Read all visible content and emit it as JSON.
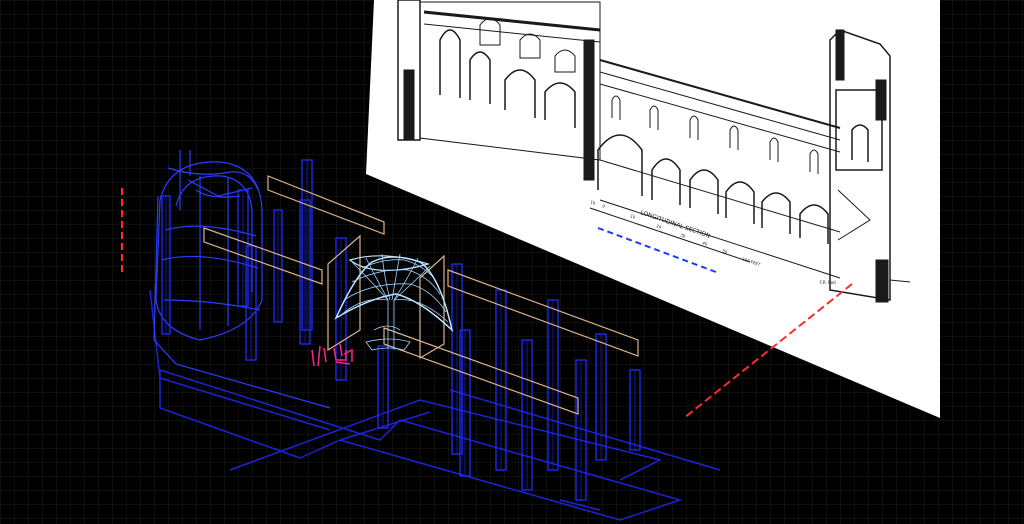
{
  "viewport": {
    "background": "#000000",
    "grid_color": "#1c1c1c",
    "model_colors": {
      "columns": "#1f2bff",
      "wall_drum": "#2a3cff",
      "vault": "#9fd4ff",
      "frames": "#d9b48a",
      "figures": "#ff1f8e",
      "section_line": "#ff2a2a",
      "floor_outline": "#1a24d8"
    }
  },
  "reference_sheet": {
    "paper_color": "#ffffff",
    "ink_color": "#1a1a1a",
    "scale_title": "LONGITUDINAL SECTION",
    "scale_ticks": [
      "10",
      "0",
      "10",
      "20",
      "30",
      "40",
      "50",
      "100 FEET"
    ],
    "annotation": "F.R. Red"
  }
}
